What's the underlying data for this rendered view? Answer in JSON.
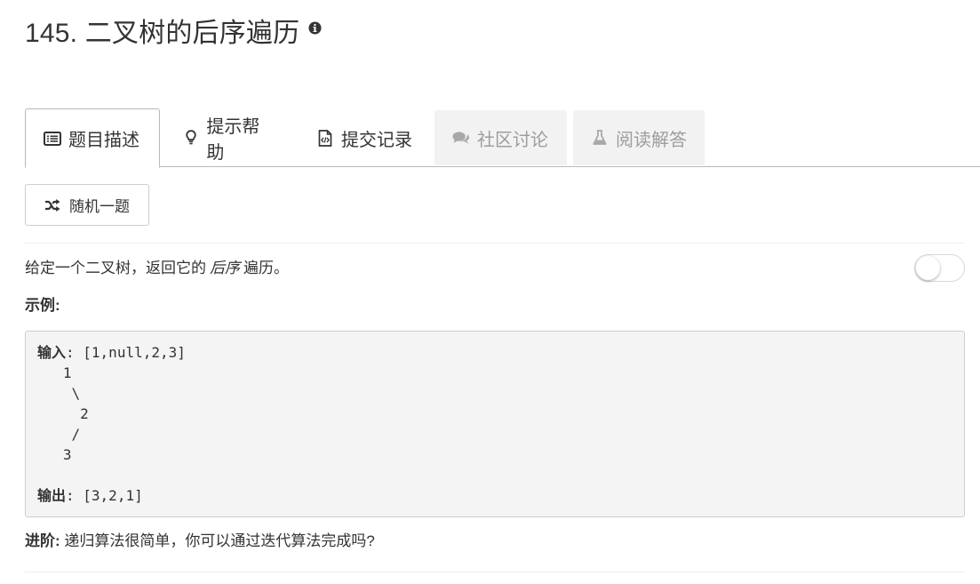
{
  "problem": {
    "title": "145. 二叉树的后序遍历"
  },
  "tabs": [
    {
      "label": "题目描述",
      "icon": "list-alt-icon",
      "state": "active"
    },
    {
      "label": "提示帮助",
      "icon": "lightbulb-icon",
      "state": "normal"
    },
    {
      "label": "提交记录",
      "icon": "file-code-icon",
      "state": "normal"
    },
    {
      "label": "社区讨论",
      "icon": "comments-icon",
      "state": "disabled"
    },
    {
      "label": "阅读解答",
      "icon": "flask-icon",
      "state": "disabled"
    }
  ],
  "random_button": {
    "label": "随机一题",
    "icon": "random-icon"
  },
  "description": {
    "before": "给定一个二叉树，返回它的",
    "emphasis": "后序",
    "after": "遍历。"
  },
  "toggle": {
    "on": false
  },
  "example": {
    "label": "示例:",
    "input_label": "输入",
    "input_value": ": [1,null,2,3]",
    "tree_lines": [
      "   1",
      "    \\",
      "     2",
      "    /",
      "   3"
    ],
    "output_label": "输出",
    "output_value": ": [3,2,1]"
  },
  "followup": {
    "label": "进阶:",
    "text": " 递归算法很简单，你可以通过迭代算法完成吗?"
  }
}
